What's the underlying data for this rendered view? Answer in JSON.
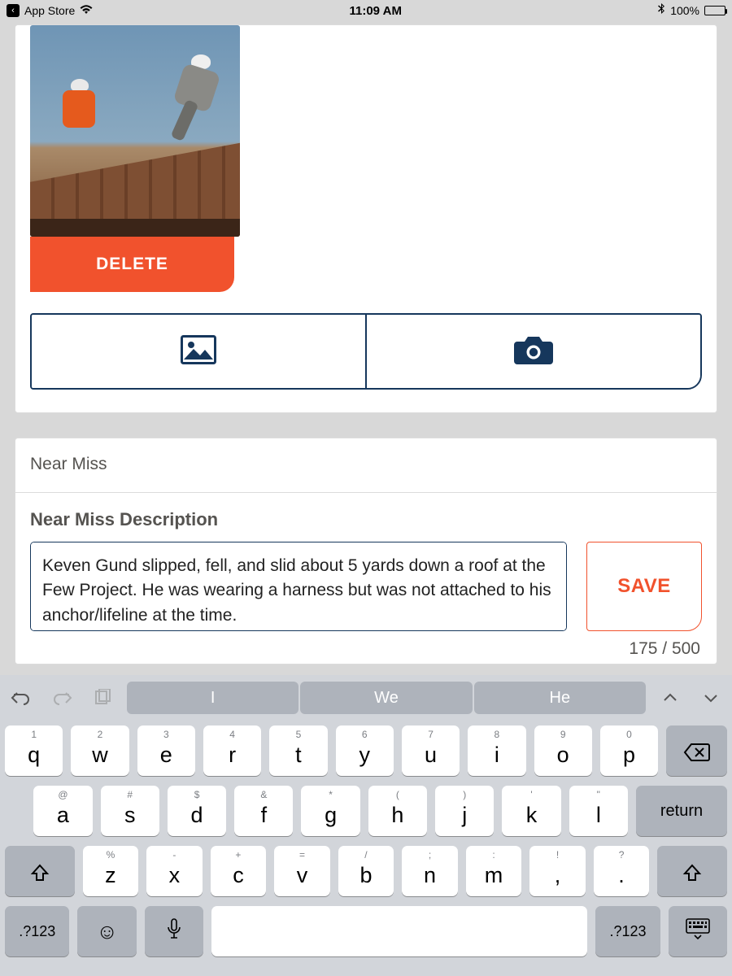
{
  "status": {
    "app_label": "App Store",
    "time": "11:09 AM",
    "battery_pct": "100%"
  },
  "photo": {
    "delete_label": "DELETE"
  },
  "near_miss": {
    "section_title": "Near Miss",
    "desc_label": "Near Miss Description",
    "desc_value": "Keven Gund slipped, fell, and slid about 5 yards down a roof at the Few Project. He was wearing a harness but was not attached to his anchor/lifeline at the time.",
    "counter": "175 / 500",
    "save_label": "SAVE"
  },
  "keyboard": {
    "suggestions": [
      "I",
      "We",
      "He"
    ],
    "row1_sup": [
      "1",
      "2",
      "3",
      "4",
      "5",
      "6",
      "7",
      "8",
      "9",
      "0"
    ],
    "row1": [
      "q",
      "w",
      "e",
      "r",
      "t",
      "y",
      "u",
      "i",
      "o",
      "p"
    ],
    "row2_sup": [
      "@",
      "#",
      "$",
      "&",
      "*",
      "(",
      ")",
      "'",
      "\""
    ],
    "row2": [
      "a",
      "s",
      "d",
      "f",
      "g",
      "h",
      "j",
      "k",
      "l"
    ],
    "return_label": "return",
    "row3_sup": [
      "%",
      "-",
      "+",
      "=",
      "/",
      ";",
      ":",
      "!",
      "?"
    ],
    "row3": [
      "z",
      "x",
      "c",
      "v",
      "b",
      "n",
      "m",
      ",",
      "."
    ],
    "sym_label": ".?123"
  }
}
